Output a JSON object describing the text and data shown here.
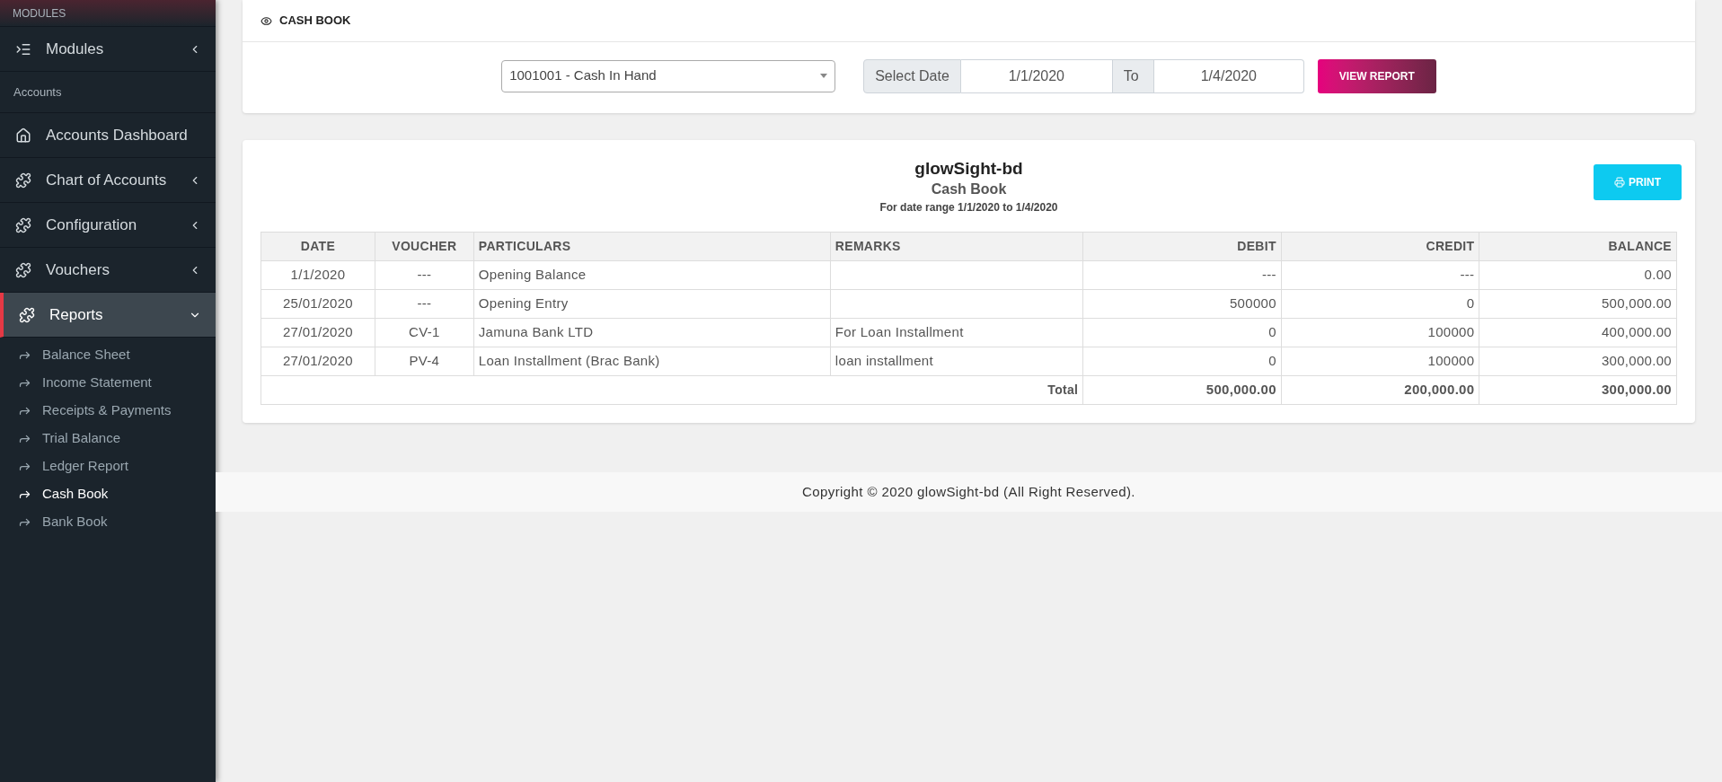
{
  "sidebar": {
    "top_label": "MODULES",
    "items": [
      {
        "kind": "menu",
        "label": "Modules",
        "expanded": false,
        "selected": false
      },
      {
        "kind": "section",
        "label": "Accounts"
      },
      {
        "kind": "link",
        "label": "Accounts Dashboard",
        "selected": false
      },
      {
        "kind": "group",
        "label": "Chart of Accounts",
        "expanded": false,
        "selected": false
      },
      {
        "kind": "group",
        "label": "Configuration",
        "expanded": false,
        "selected": false
      },
      {
        "kind": "group",
        "label": "Vouchers",
        "expanded": false,
        "selected": false
      },
      {
        "kind": "group",
        "label": "Reports",
        "expanded": true,
        "selected": true,
        "children": [
          {
            "label": "Balance Sheet",
            "selected": false
          },
          {
            "label": "Income Statement",
            "selected": false
          },
          {
            "label": "Receipts & Payments",
            "selected": false
          },
          {
            "label": "Trial Balance",
            "selected": false
          },
          {
            "label": "Ledger Report",
            "selected": false
          },
          {
            "label": "Cash Book",
            "selected": true
          },
          {
            "label": "Bank Book",
            "selected": false
          }
        ]
      }
    ]
  },
  "filter_card": {
    "title": "CASH BOOK",
    "account_select": {
      "value": "1001001 - Cash In Hand"
    },
    "date_label": "Select Date",
    "from_date": {
      "value": "1/1/2020"
    },
    "to_label": "To",
    "to_date": {
      "value": "1/4/2020"
    },
    "view_button": "VIEW REPORT"
  },
  "report": {
    "company": "glowSight-bd",
    "title": "Cash Book",
    "subtitle": "For date range 1/1/2020 to 1/4/2020",
    "print_button": "PRINT",
    "table": {
      "columns": [
        "DATE",
        "VOUCHER",
        "PARTICULARS",
        "REMARKS",
        "DEBIT",
        "CREDIT",
        "BALANCE"
      ],
      "rows": [
        [
          "1/1/2020",
          "---",
          "Opening Balance",
          "",
          "---",
          "---",
          "0.00"
        ],
        [
          "25/01/2020",
          "---",
          "Opening Entry",
          "",
          "500000",
          "0",
          "500,000.00"
        ],
        [
          "27/01/2020",
          "CV-1",
          "Jamuna Bank LTD",
          "For Loan Installment",
          "0",
          "100000",
          "400,000.00"
        ],
        [
          "27/01/2020",
          "PV-4",
          "Loan Installment (Brac Bank)",
          "loan installment",
          "0",
          "100000",
          "300,000.00"
        ]
      ],
      "total": {
        "label": "Total",
        "values": [
          "500,000.00",
          "200,000.00",
          "300,000.00"
        ]
      }
    }
  },
  "footer": "Copyright © 2020 glowSight-bd (All Right Reserved)."
}
